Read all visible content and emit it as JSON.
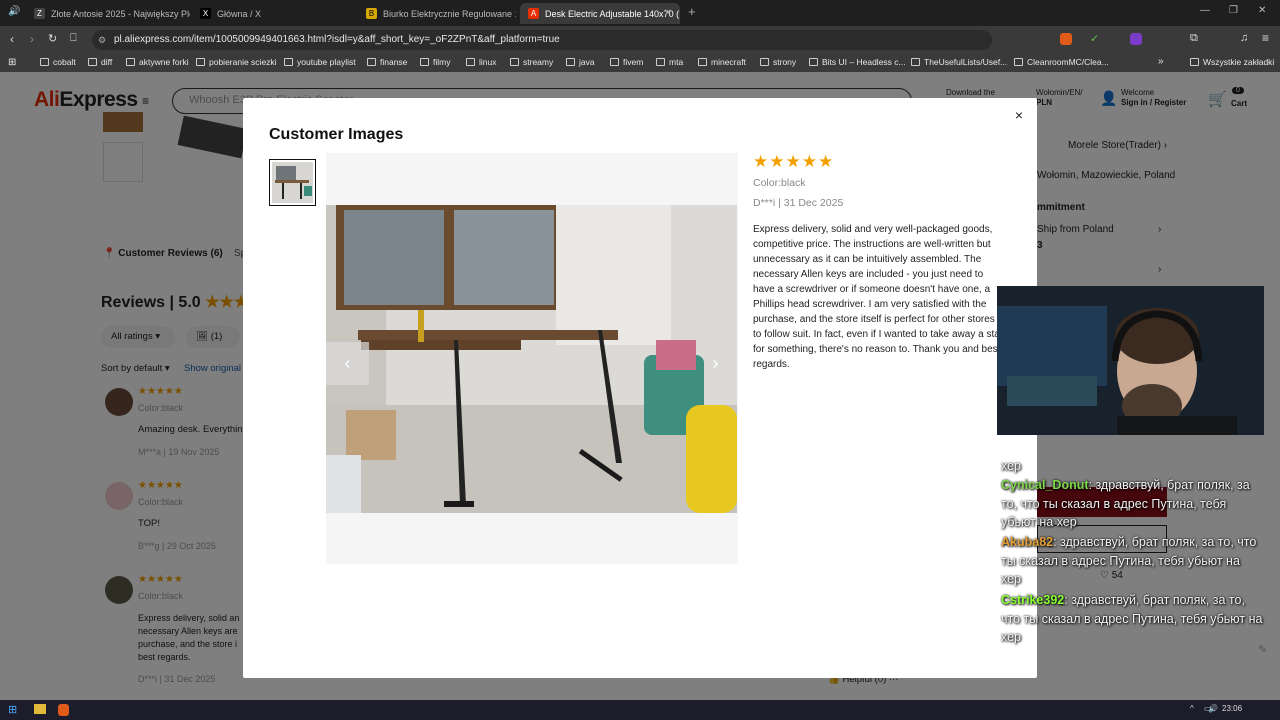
{
  "browser": {
    "tabs": [
      {
        "title": "Złote Antosie 2025 - Największy Plebi",
        "fav": "Z",
        "fav_color": "#444"
      },
      {
        "title": "Główna / X",
        "fav": "X",
        "fav_color": "#000"
      },
      {
        "title": "Biurko Elektrycznie Regulowane 140x7",
        "fav": "B",
        "fav_color": "#d6a800"
      },
      {
        "title": "Desk Electric Adjustable 140x70 (",
        "fav": "A",
        "fav_color": "#e62e04"
      }
    ],
    "new_tab": "+",
    "url": "pl.aliexpress.com/item/1005009949401663.html?isdl=y&aff_short_key=_oF2ZPnT&aff_platform=true",
    "bookmarks": [
      "cobalt",
      "diff",
      "aktywne forki",
      "pobieranie sciezki",
      "youtube playlist",
      "finanse",
      "filmy",
      "linux",
      "streamy",
      "java",
      "fivem",
      "mta",
      "minecraft",
      "strony",
      "Bits UI – Headless c...",
      "TheUsefulLists/Usef...",
      "CleanroomMC/Clea..."
    ],
    "all_bookmarks": "Wszystkie zakładki"
  },
  "header": {
    "logo": "AliExpress",
    "search_placeholder": "Whoosh E3P Pro Electric Scooter",
    "download": "Download the",
    "lang": "Wołomin/EN/",
    "currency": "PLN",
    "welcome": "Welcome",
    "signin": "Sign in / Register",
    "cart_count": "0",
    "cart": "Cart"
  },
  "background": {
    "reviews_tab": "Customer Reviews (6)",
    "spec_tab": "Sp",
    "reviews_title": "Reviews",
    "rating": "5.0",
    "all_ratings": "All ratings",
    "images_filter": "(1)",
    "sort": "Sort by default",
    "show_original": "Show original",
    "reviews": [
      {
        "color": "Color:black",
        "text": "Amazing desk. Everythin",
        "meta": "M***a | 19 Nov 2025"
      },
      {
        "color": "Color:black",
        "text": "TOP!",
        "meta": "B***g | 29 Oct 2025"
      },
      {
        "color": "Color:black",
        "text": "Express delivery, solid an\nnecessary Allen keys are\npurchase, and the store i\nbest regards.",
        "meta": "D***i | 31 Dec 2025"
      }
    ],
    "store": "Morele Store(Trader)",
    "location": "Wołomin, Mazowieckie, Poland",
    "commitment": "mmitment",
    "ship_from": "Ship from Poland",
    "ship_num": "3",
    "helpful_count": "54",
    "helpful": "Helpful (0)"
  },
  "modal": {
    "title": "Customer Images",
    "stars": "★★★★★",
    "color": "Color:black",
    "meta": "D***i | 31 Dec 2025",
    "review": "Express delivery, solid and very well-packaged goods, competitive price. The instructions are well-written but unnecessary as it can be intuitively assembled. The necessary Allen keys are included - you just need to have a screwdriver or if someone doesn't have one, a Phillips head screwdriver. I am very satisfied with the purchase, and the store itself is perfect for other stores to follow suit. In fact, even if I wanted to take away a sta for something, there's no reason to. Thank you and best regards.",
    "close": "×"
  },
  "chat": [
    {
      "user": "",
      "text": "хер",
      "color": "#ffffff"
    },
    {
      "user": "Cynical_Donut",
      "text": ": здравствуй, брат поляк, за то, что ты сказал в адрес Путина, тебя убьют на хер",
      "color": "#7fd84a"
    },
    {
      "user": "Akuba82",
      "text": ": здравствуй, брат поляк, за то, что ты сказал в адрес Путина, тебя убьют на хер",
      "color": "#e8a23a"
    },
    {
      "user": "Cstrike392",
      "text": ": здравствуй, брат поляк, за то, что ты сказал в адрес Путина, тебя убьют на хер",
      "color": "#8aff33"
    }
  ],
  "taskbar": {
    "time": "23:06"
  }
}
